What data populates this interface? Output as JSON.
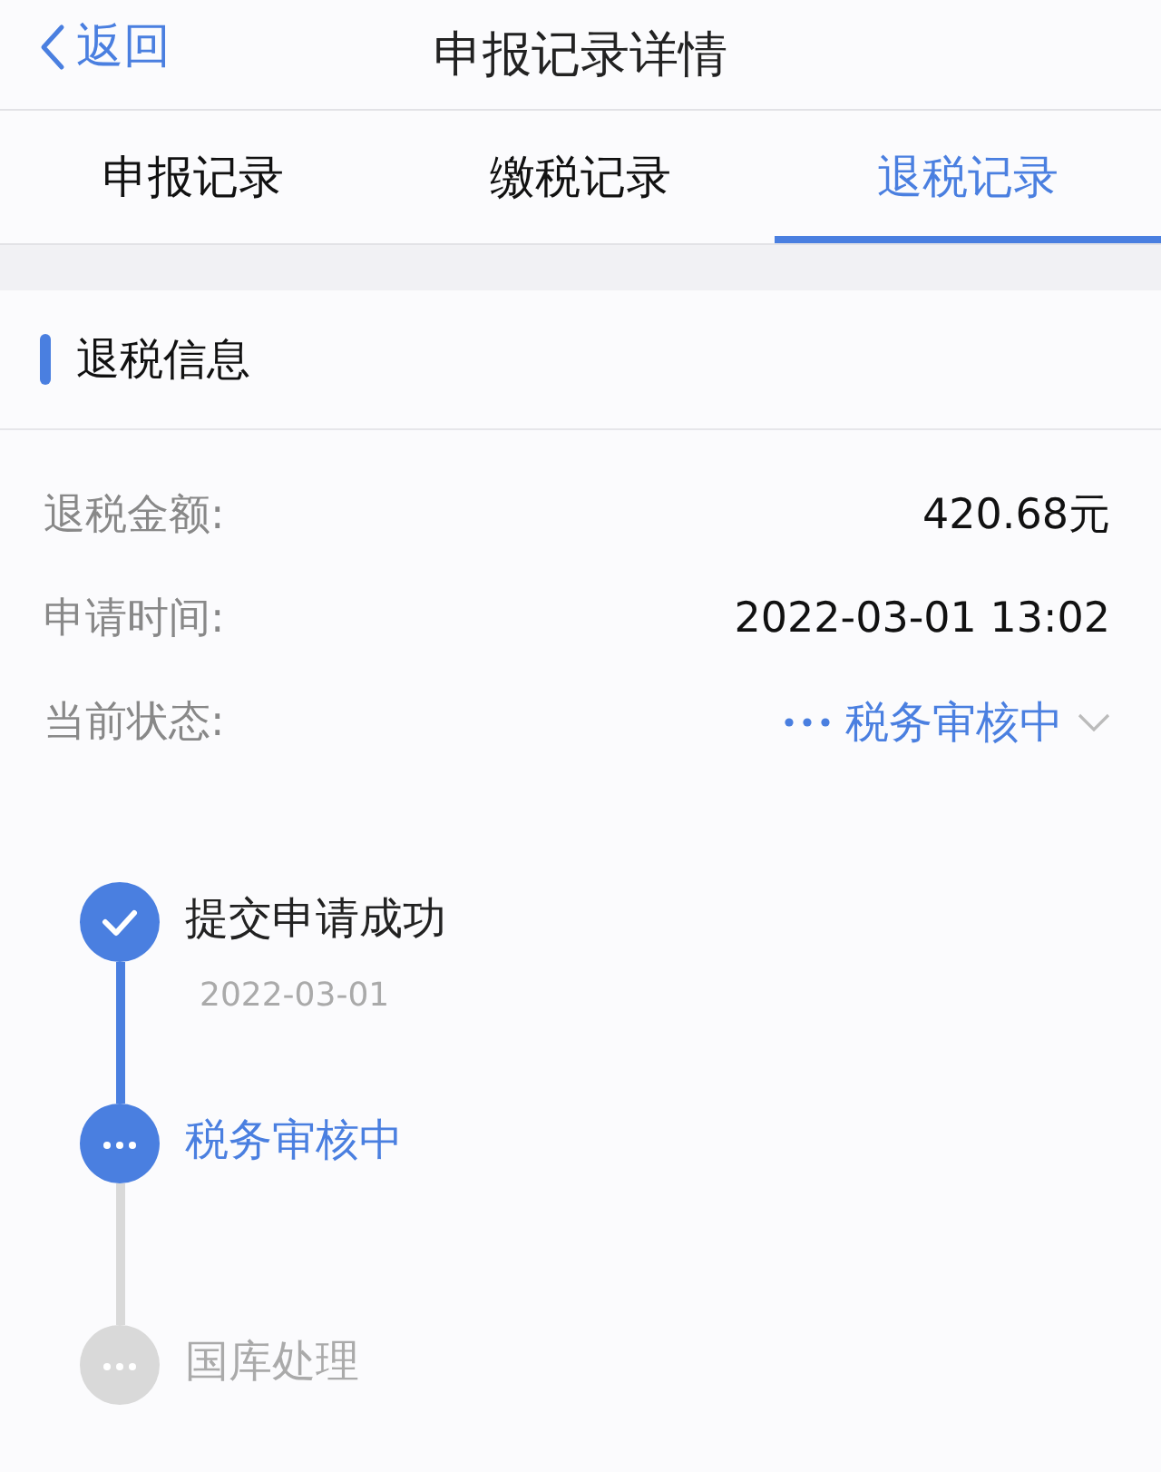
{
  "nav": {
    "back": "返回",
    "title": "申报记录详情"
  },
  "tabs": [
    {
      "label": "申报记录",
      "selected": false
    },
    {
      "label": "缴税记录",
      "selected": false
    },
    {
      "label": "退税记录",
      "selected": true
    }
  ],
  "section": {
    "title": "退税信息"
  },
  "fields": [
    {
      "label": "退税金额:",
      "value": "420.68元",
      "kind": "text"
    },
    {
      "label": "申请时间:",
      "value": "2022-03-01 13:02",
      "kind": "text"
    },
    {
      "label": "当前状态:",
      "value": "税务审核中",
      "kind": "status"
    }
  ],
  "timeline": [
    {
      "title": "提交申请成功",
      "date": "2022-03-01",
      "kind": "done"
    },
    {
      "title": "税务审核中",
      "kind": "active"
    },
    {
      "title": "国库处理",
      "kind": "pending"
    }
  ]
}
